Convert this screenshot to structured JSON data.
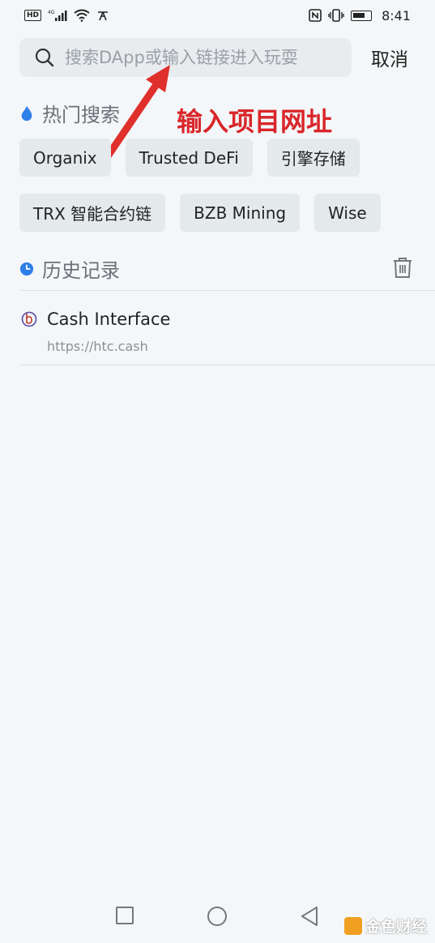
{
  "status_bar": {
    "time": "8:41",
    "left_icons": [
      "hd-icon",
      "signal-4g-icon",
      "wifi-icon",
      "usb-icon"
    ],
    "right_icons": [
      "nfc-icon",
      "vibrate-icon",
      "battery-icon"
    ]
  },
  "search": {
    "placeholder": "搜索DApp或输入链接进入玩耍",
    "cancel_label": "取消"
  },
  "annotation": {
    "text": "输入项目网址",
    "color": "#d9262a"
  },
  "hot_search": {
    "title": "热门搜索",
    "icon": "flame-icon",
    "tags_row1": [
      "Organix",
      "Trusted DeFi",
      "引擎存储"
    ],
    "tags_row2": [
      "TRX 智能合约链",
      "BZB Mining",
      "Wise"
    ]
  },
  "history": {
    "title": "历史记录",
    "icon": "clock-icon",
    "clear_icon": "trash-icon",
    "items": [
      {
        "name": "Cash Interface",
        "url": "https://htc.cash"
      }
    ]
  },
  "nav": {
    "buttons": [
      "recents-icon",
      "home-icon",
      "back-icon"
    ]
  },
  "watermark": "金色财经",
  "colors": {
    "background": "#f4f7f9",
    "accent_blue": "#2f7fe8",
    "annotation_red": "#d9262a"
  }
}
